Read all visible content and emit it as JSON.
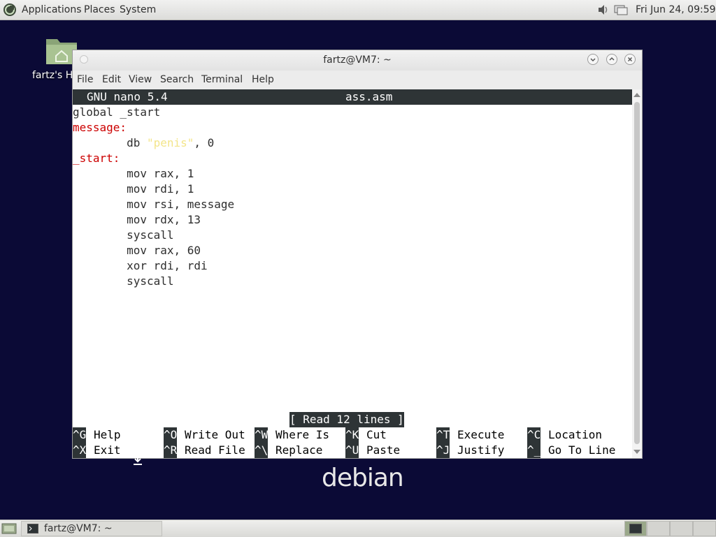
{
  "top_panel": {
    "menus": [
      "Applications",
      "Places",
      "System"
    ],
    "clock": "Fri Jun 24, 09:59"
  },
  "desktop": {
    "home_icon_label": "fartz's H",
    "debian_logo": "debian"
  },
  "window": {
    "title": "fartz@VM7: ~",
    "menus": [
      "File",
      "Edit",
      "View",
      "Search",
      "Terminal",
      "Help"
    ]
  },
  "nano": {
    "version": "GNU nano 5.4",
    "filename": "ass.asm",
    "lines": [
      {
        "plain": "global _start"
      },
      {
        "label": "message:"
      },
      {
        "prefix": "        db ",
        "string": "\"penis\"",
        "suffix": ", 0"
      },
      {
        "label": "_start:"
      },
      {
        "plain": "        mov rax, 1"
      },
      {
        "plain": "        mov rdi, 1"
      },
      {
        "plain": "        mov rsi, message"
      },
      {
        "plain": "        mov rdx, 13"
      },
      {
        "plain": "        syscall"
      },
      {
        "plain": "        mov rax, 60"
      },
      {
        "plain": "        xor rdi, rdi"
      },
      {
        "plain": "        syscall"
      }
    ],
    "status": "[ Read 12 lines ]",
    "shortcuts_row1": [
      {
        "key": "^G",
        "label": "Help"
      },
      {
        "key": "^O",
        "label": "Write Out"
      },
      {
        "key": "^W",
        "label": "Where Is"
      },
      {
        "key": "^K",
        "label": "Cut"
      },
      {
        "key": "^T",
        "label": "Execute"
      },
      {
        "key": "^C",
        "label": "Location"
      }
    ],
    "shortcuts_row2": [
      {
        "key": "^X",
        "label": "Exit"
      },
      {
        "key": "^R",
        "label": "Read File"
      },
      {
        "key": "^\\",
        "label": "Replace"
      },
      {
        "key": "^U",
        "label": "Paste"
      },
      {
        "key": "^J",
        "label": "Justify"
      },
      {
        "key": "^_",
        "label": "Go To Line"
      }
    ]
  },
  "taskbar": {
    "task_label": "fartz@VM7: ~"
  },
  "colors": {
    "desktop_bg": "#0b0a36",
    "label_red": "#cc0000",
    "string_yellow": "#f3e58a",
    "nano_bar": "#2e3436"
  }
}
